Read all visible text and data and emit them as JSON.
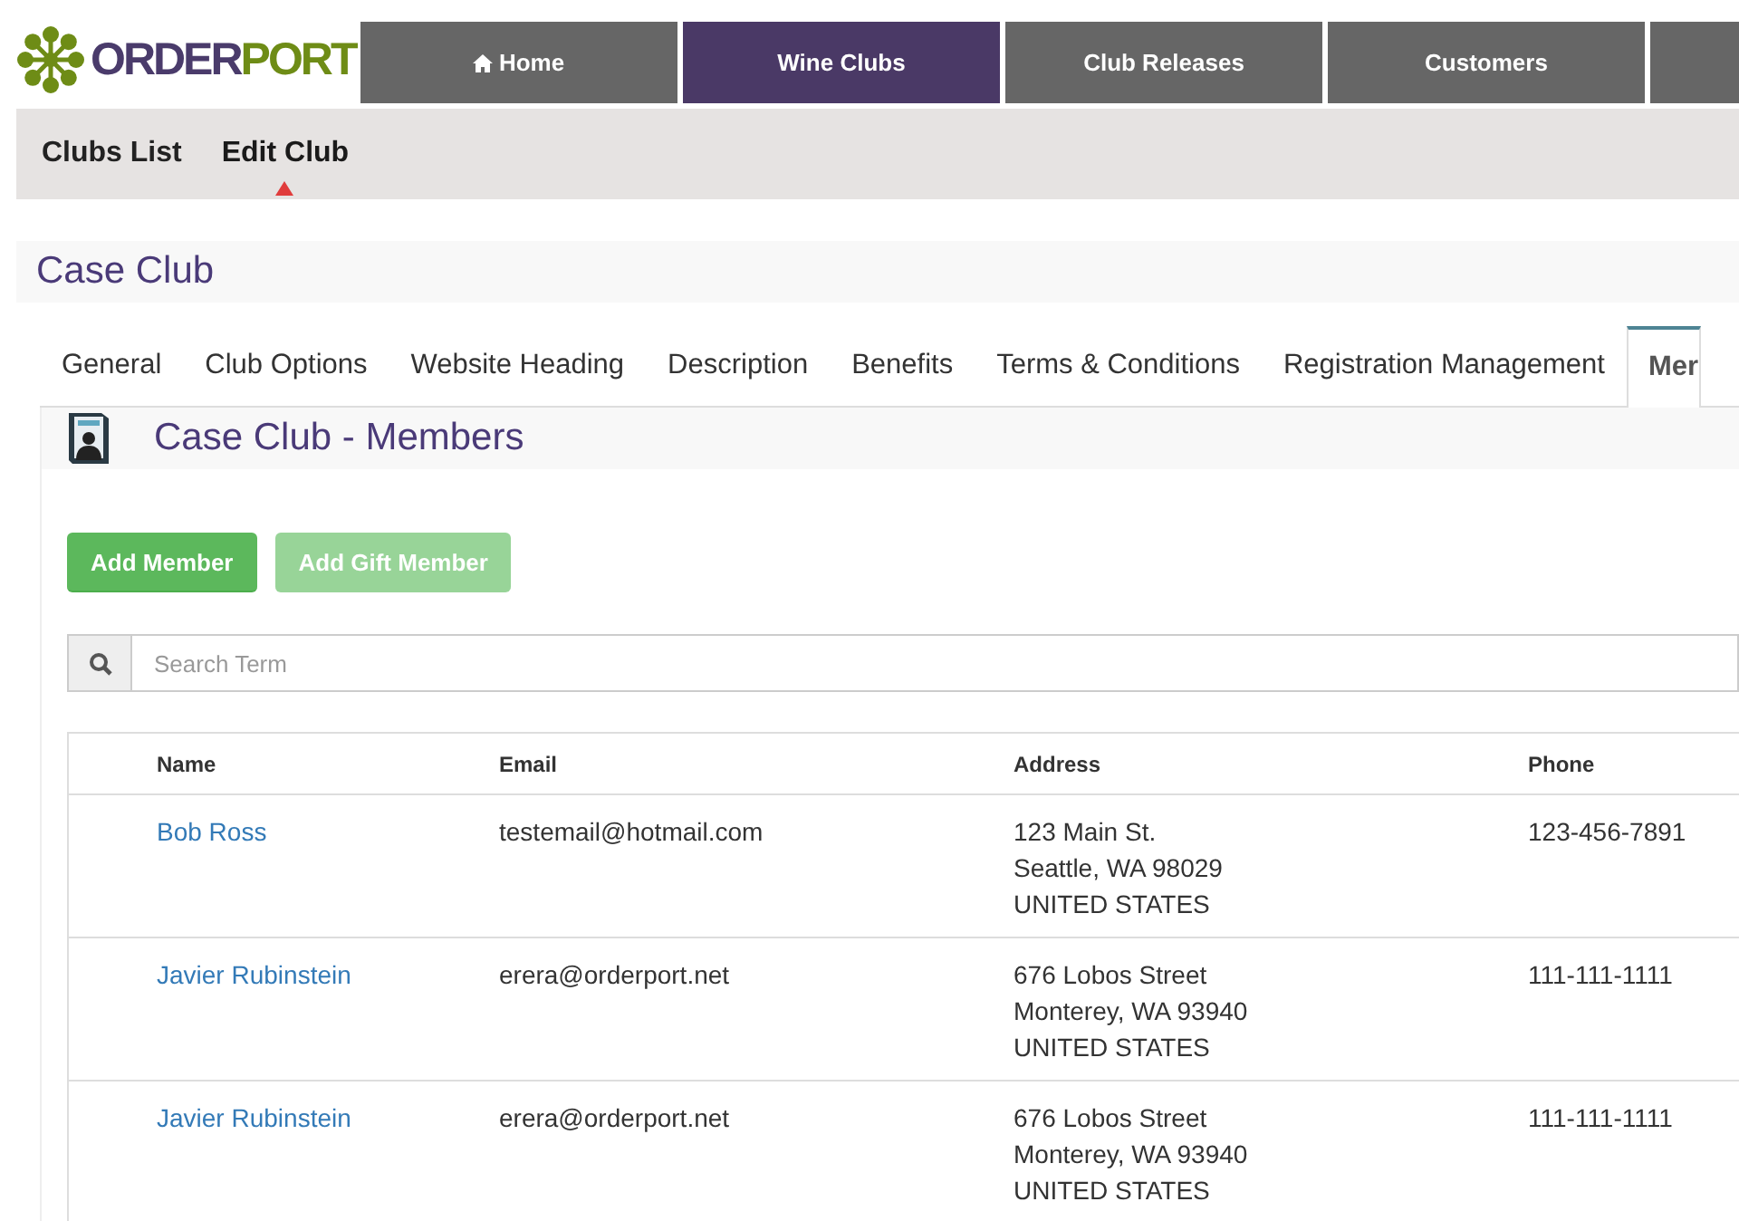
{
  "logo": {
    "part_1": "ORDER",
    "part_2": "PORT"
  },
  "main_nav": [
    {
      "label": "Home",
      "kind": "home",
      "selected": false
    },
    {
      "label": "Wine Clubs",
      "kind": "text",
      "selected": true
    },
    {
      "label": "Club Releases",
      "kind": "text",
      "selected": false
    },
    {
      "label": "Customers",
      "kind": "text",
      "selected": false
    }
  ],
  "sub_nav": [
    {
      "label": "Clubs List",
      "selected": false
    },
    {
      "label": "Edit Club",
      "selected": true
    }
  ],
  "page_title": "Case Club",
  "tabs": [
    {
      "label": "General",
      "selected": false
    },
    {
      "label": "Club Options",
      "selected": false
    },
    {
      "label": "Website Heading",
      "selected": false
    },
    {
      "label": "Description",
      "selected": false
    },
    {
      "label": "Benefits",
      "selected": false
    },
    {
      "label": "Terms & Conditions",
      "selected": false
    },
    {
      "label": "Registration Management",
      "selected": false
    },
    {
      "label": "Mer",
      "selected": true
    }
  ],
  "panel": {
    "title": "Case Club - Members",
    "buttons": [
      {
        "label": "Add Member",
        "disabled": false
      },
      {
        "label": "Add Gift Member",
        "disabled": true
      }
    ],
    "search": {
      "placeholder": "Search Term"
    },
    "table": {
      "columns": [
        "Name",
        "Email",
        "Address",
        "Phone"
      ],
      "rows": [
        {
          "name": "Bob Ross",
          "email": "testemail@hotmail.com",
          "address": [
            "123 Main St.",
            "Seattle, WA 98029",
            "UNITED STATES"
          ],
          "phone": "123-456-7891"
        },
        {
          "name": "Javier Rubinstein",
          "email": "erera@orderport.net",
          "address": [
            "676 Lobos Street",
            "Monterey, WA 93940",
            "UNITED STATES"
          ],
          "phone": "111-111-1111"
        },
        {
          "name": "Javier Rubinstein",
          "email": "erera@orderport.net",
          "address": [
            "676 Lobos Street",
            "Monterey, WA 93940",
            "UNITED STATES"
          ],
          "phone": "111-111-1111"
        }
      ]
    }
  }
}
